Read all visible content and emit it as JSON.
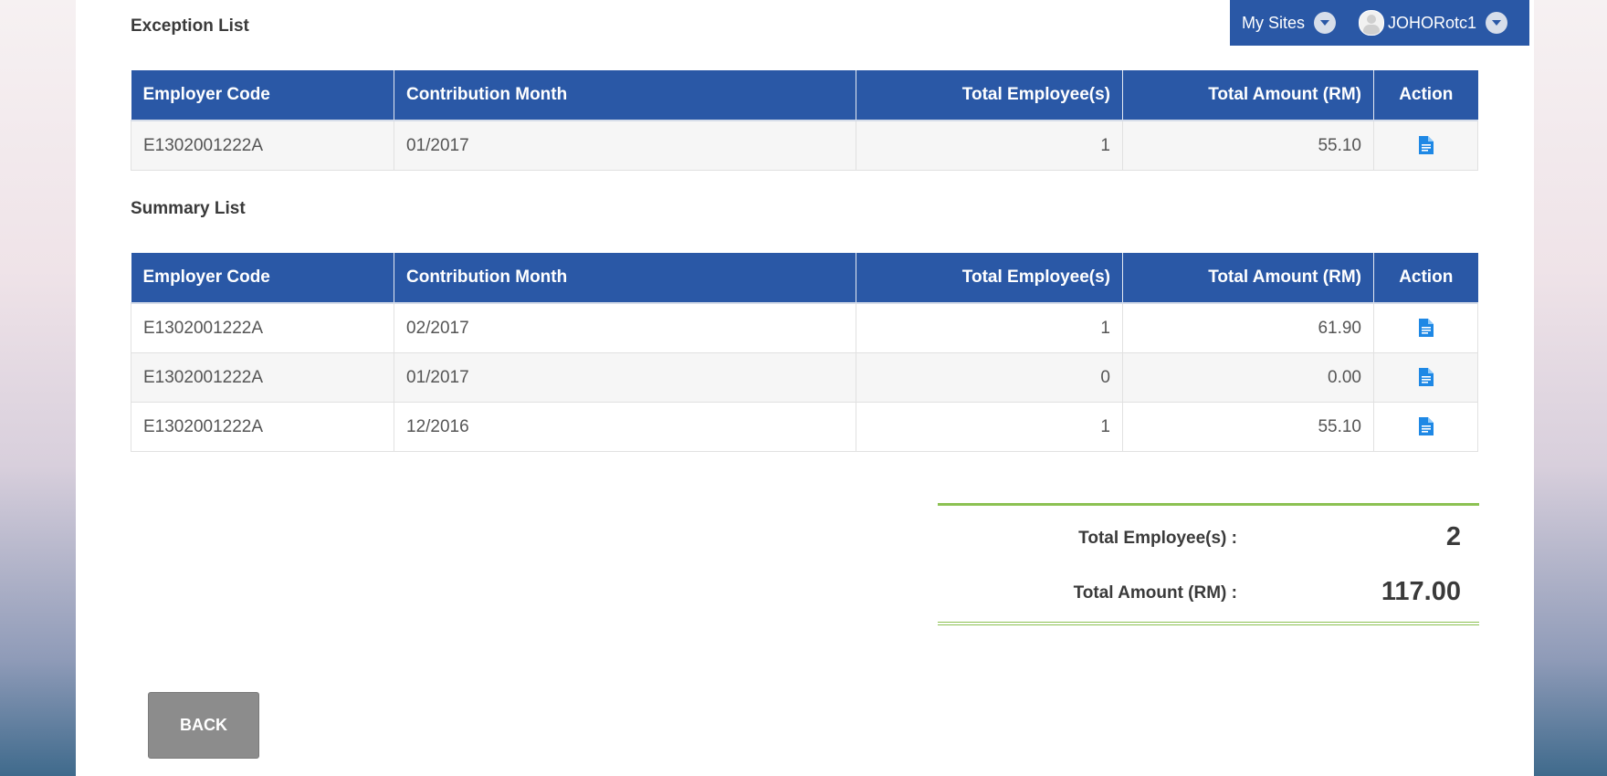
{
  "header": {
    "my_sites_label": "My Sites",
    "username": "JOHORotc1"
  },
  "exception": {
    "title": "Exception List",
    "columns": [
      "Employer Code",
      "Contribution Month",
      "Total Employee(s)",
      "Total Amount (RM)",
      "Action"
    ],
    "rows": [
      {
        "employer_code": "E1302001222A",
        "month": "01/2017",
        "employees": "1",
        "amount": "55.10"
      }
    ]
  },
  "summary": {
    "title": "Summary List",
    "columns": [
      "Employer Code",
      "Contribution Month",
      "Total Employee(s)",
      "Total Amount (RM)",
      "Action"
    ],
    "rows": [
      {
        "employer_code": "E1302001222A",
        "month": "02/2017",
        "employees": "1",
        "amount": "61.90"
      },
      {
        "employer_code": "E1302001222A",
        "month": "01/2017",
        "employees": "0",
        "amount": "0.00"
      },
      {
        "employer_code": "E1302001222A",
        "month": "12/2016",
        "employees": "1",
        "amount": "55.10"
      }
    ]
  },
  "totals": {
    "employees_label": "Total Employee(s) :",
    "employees_value": "2",
    "amount_label": "Total Amount (RM) :",
    "amount_value": "117.00"
  },
  "back_label": "BACK",
  "colors": {
    "header_blue": "#2a58a6",
    "icon_blue": "#1e88e5",
    "accent_green": "#8cc152",
    "button_gray": "#8c8c8c"
  },
  "icons": {
    "action": "document-icon",
    "caret": "chevron-down-icon"
  }
}
